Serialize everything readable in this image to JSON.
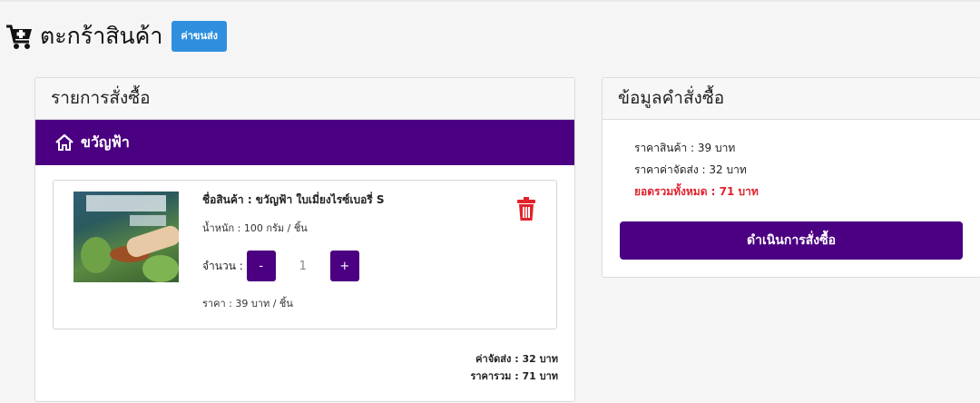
{
  "header": {
    "title": "ตะกร้าสินค้า",
    "shipping_button": "ค่าขนส่ง",
    "icon": "cart-plus-icon"
  },
  "order_list": {
    "heading": "รายการสั่งซื้อ",
    "shop_name": "ขวัญฟ้า",
    "shop_icon": "home-icon",
    "item": {
      "name": "ชื่อสินค้า : ขวัญฟ้า ใบเมี่ยงไรซ์เบอรี่ S",
      "weight": "น้ำหนัก : 100 กรัม / ชิ้น",
      "quantity_label": "จำนวน :",
      "minus": "-",
      "quantity": "1",
      "plus": "+",
      "price": "ราคา : 39 บาท / ชิ้น",
      "delete_icon": "trash-icon"
    },
    "shipping_cost": "ค่าจัดส่ง : 32 บาท",
    "total": "ราคารวม : 71 บาท"
  },
  "order_info": {
    "heading": "ข้อมูลคำสั่งซื้อ",
    "product_price": "ราคาสินค้า : 39 บาท",
    "shipping_price": "ราคาค่าจัดส่ง : 32 บาท",
    "grand_total": "ยอดรวมทั้งหมด : 71 บาท",
    "checkout_button": "ดำเนินการสั่งซื้อ"
  },
  "colors": {
    "primary": "#4b0082",
    "accent_blue": "#2f8fde",
    "danger": "#e0222d"
  }
}
